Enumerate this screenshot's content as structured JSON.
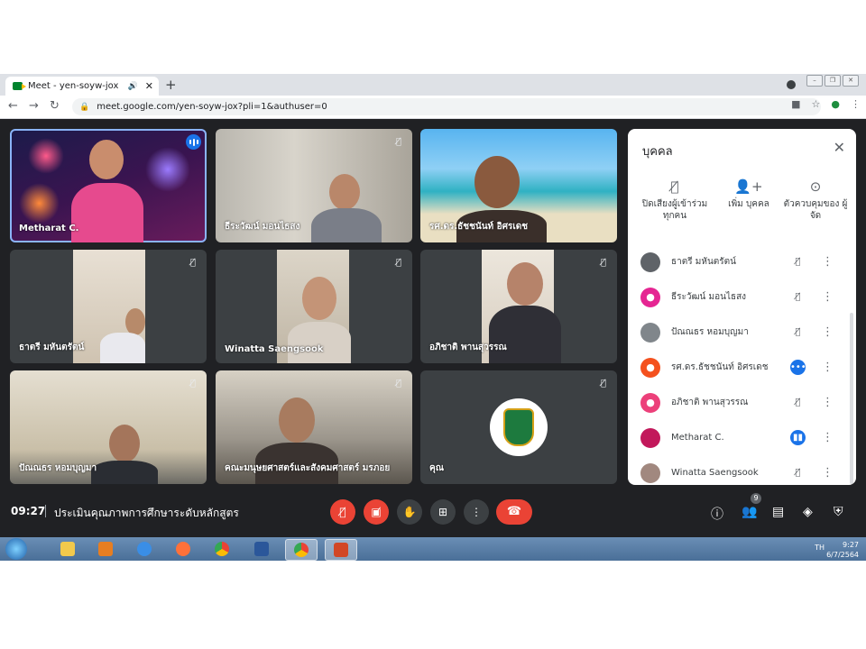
{
  "browser": {
    "tab_title": "Meet - yen-soyw-jox",
    "audio_icon": "speaker-icon",
    "url": "meet.google.com/yen-soyw-jox?pli=1&authuser=0"
  },
  "tiles": [
    {
      "name": "Metharat C.",
      "status": "speaking"
    },
    {
      "name": "ธีระวัฒน์ มอนไธสง",
      "status": "muted"
    },
    {
      "name": "รศ.ดร.ธัชชนันท์ อิศรเดช",
      "status": ""
    },
    {
      "name": "ธาตรี มหันตรัตน์",
      "status": "muted"
    },
    {
      "name": "Winatta Saengsook",
      "status": "muted"
    },
    {
      "name": "อภิชาติ พานสุวรรณ",
      "status": "muted"
    },
    {
      "name": "ปัณณธร หอมบุญมา",
      "status": "muted"
    },
    {
      "name": "คณะมนุษยศาสตร์และสังคมศาสตร์ มรภอย",
      "status": "muted"
    },
    {
      "name": "คุณ",
      "status": "muted"
    }
  ],
  "panel": {
    "title": "บุคคล",
    "actions": [
      {
        "icon": "mic-off-icon",
        "label": "ปิดเสียงผู้เข้าร่วม ทุกคน"
      },
      {
        "icon": "add-person-icon",
        "label": "เพิ่ม บุคคล"
      },
      {
        "icon": "toggle-icon",
        "label": "ตัวควบคุมของ ผู้จัด"
      }
    ],
    "participants": [
      {
        "name": "ธาตรี มหันตรัตน์",
        "mic": "muted",
        "avatar_color": "#5f6368"
      },
      {
        "name": "ธีระวัฒน์ มอนไธสง",
        "mic": "muted",
        "avatar_color": "#e52592"
      },
      {
        "name": "ปัณณธร หอมบุญมา",
        "mic": "muted",
        "avatar_color": "#80868b"
      },
      {
        "name": "รศ.ดร.ธัชชนันท์ อิศรเดช",
        "mic": "idle",
        "avatar_color": "#f4511e"
      },
      {
        "name": "อภิชาติ พานสุวรรณ",
        "mic": "muted",
        "avatar_color": "#ec407a"
      },
      {
        "name": "Metharat C.",
        "mic": "speaking",
        "avatar_color": "#c2185b"
      },
      {
        "name": "Winatta Saengsook",
        "mic": "muted",
        "avatar_color": "#a1887f"
      }
    ]
  },
  "controls": {
    "time": "09:27",
    "meeting_title": "ประเมินคุณภาพการศึกษาระดับหลักสูตร",
    "people_count": "9"
  },
  "taskbar": {
    "lang": "TH",
    "time": "9:27",
    "date": "6/7/2564"
  }
}
